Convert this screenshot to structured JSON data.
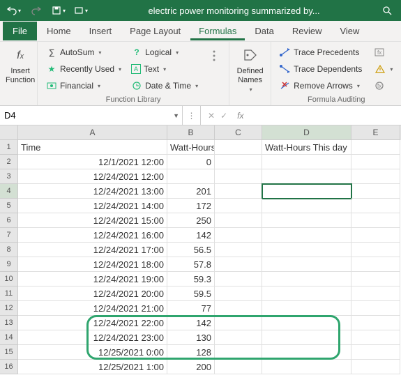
{
  "titlebar": {
    "title": "electric power monitoring summarized by..."
  },
  "tabs": {
    "file": "File",
    "home": "Home",
    "insert": "Insert",
    "pagelayout": "Page Layout",
    "formulas": "Formulas",
    "data": "Data",
    "review": "Review",
    "view": "View"
  },
  "ribbon": {
    "insert_fn_l1": "Insert",
    "insert_fn_l2": "Function",
    "autosum": "AutoSum",
    "recently": "Recently Used",
    "financial": "Financial",
    "logical": "Logical",
    "text": "Text",
    "datetime": "Date & Time",
    "defined_l1": "Defined",
    "defined_l2": "Names",
    "trace_prec": "Trace Precedents",
    "trace_dep": "Trace Dependents",
    "remove_arrows": "Remove Arrows",
    "group_fnlib": "Function Library",
    "group_audit": "Formula Auditing"
  },
  "namebox": {
    "value": "D4",
    "fx": "fx"
  },
  "cols": {
    "A": "A",
    "B": "B",
    "C": "C",
    "D": "D",
    "E": "E"
  },
  "hdr": {
    "A": "Time",
    "B": "Watt-Hours",
    "D": "Watt-Hours This day"
  },
  "rows": [
    {
      "n": "1"
    },
    {
      "n": "2",
      "A": "12/1/2021 12:00",
      "B": "0"
    },
    {
      "n": "3",
      "A": "12/24/2021 12:00",
      "B": ""
    },
    {
      "n": "4",
      "A": "12/24/2021 13:00",
      "B": "201"
    },
    {
      "n": "5",
      "A": "12/24/2021 14:00",
      "B": "172"
    },
    {
      "n": "6",
      "A": "12/24/2021 15:00",
      "B": "250"
    },
    {
      "n": "7",
      "A": "12/24/2021 16:00",
      "B": "142"
    },
    {
      "n": "8",
      "A": "12/24/2021 17:00",
      "B": "56.5"
    },
    {
      "n": "9",
      "A": "12/24/2021 18:00",
      "B": "57.8"
    },
    {
      "n": "10",
      "A": "12/24/2021 19:00",
      "B": "59.3"
    },
    {
      "n": "11",
      "A": "12/24/2021 20:00",
      "B": "59.5"
    },
    {
      "n": "12",
      "A": "12/24/2021 21:00",
      "B": "77"
    },
    {
      "n": "13",
      "A": "12/24/2021 22:00",
      "B": "142"
    },
    {
      "n": "14",
      "A": "12/24/2021 23:00",
      "B": "130"
    },
    {
      "n": "15",
      "A": "12/25/2021 0:00",
      "B": "128"
    },
    {
      "n": "16",
      "A": "12/25/2021 1:00",
      "B": "200"
    }
  ],
  "active_cell": "D4"
}
